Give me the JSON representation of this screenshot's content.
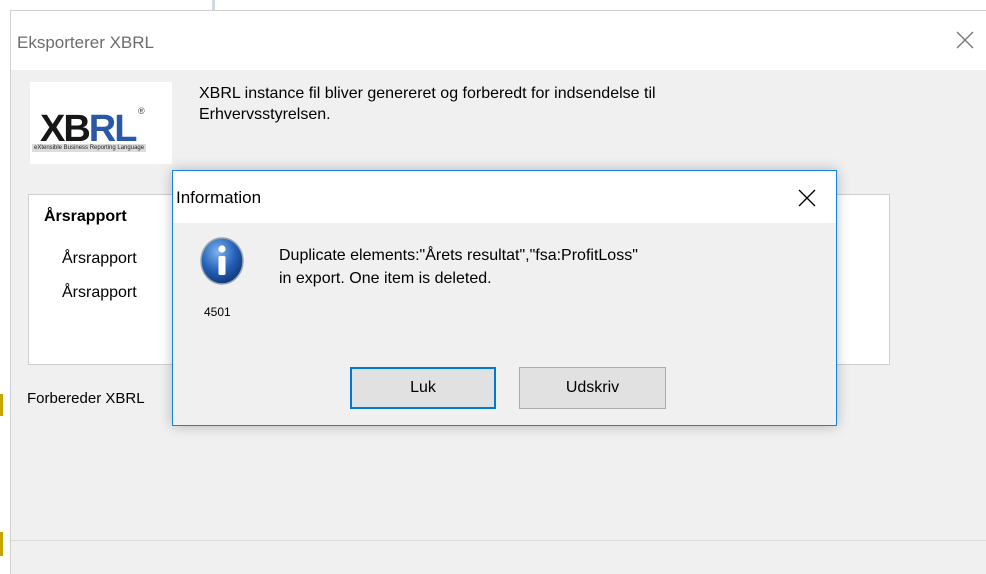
{
  "main_window": {
    "title": "Eksporterer XBRL",
    "message_line1": "XBRL instance fil bliver genereret og forberedt for indsendelse til",
    "message_line2": "Erhvervsstyrelsen.",
    "logo": {
      "text_black": "XB",
      "text_blue": "RL",
      "registered": "®",
      "subtitle": "eXtensible Business Reporting Language"
    },
    "group": {
      "title": "Årsrapport",
      "items": [
        "Årsrapport",
        "Årsrapport"
      ]
    },
    "status": "Forbereder XBRL"
  },
  "dialog": {
    "title": "Information",
    "message_line1": "Duplicate elements:\"Årets resultat\",\"fsa:ProfitLoss\"",
    "message_line2": "in export. One item is deleted.",
    "code": "4501",
    "buttons": {
      "ok_label": "Luk",
      "print_label": "Udskriv"
    },
    "icon": "info-icon"
  },
  "colors": {
    "accent": "#0078d7",
    "dialog_border": "#1883d7",
    "window_bg": "#f0f0f0",
    "info_icon_blue": "#2461b8"
  }
}
